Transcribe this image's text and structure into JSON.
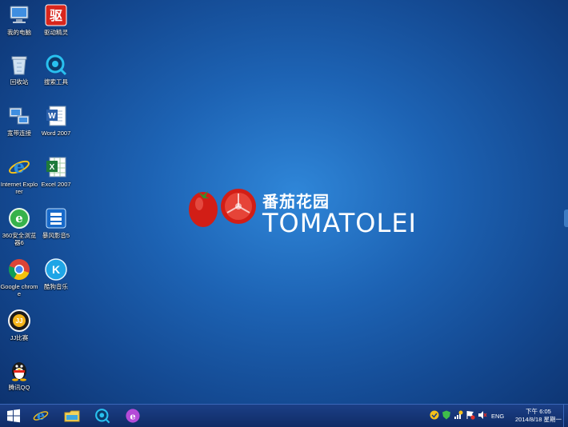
{
  "desktop_icons": [
    {
      "id": "my-computer",
      "label": "我的电脑",
      "icon": "computer-icon"
    },
    {
      "id": "driver-wizard",
      "label": "驱动精灵",
      "icon": "driver-wizard-icon"
    },
    {
      "id": "recycle-bin",
      "label": "回收站",
      "icon": "recycle-bin-icon"
    },
    {
      "id": "search-tool",
      "label": "搜索工具",
      "icon": "magnifier-icon"
    },
    {
      "id": "broadband",
      "label": "宽带连接",
      "icon": "network-icon"
    },
    {
      "id": "word",
      "label": "Word 2007",
      "icon": "word-icon"
    },
    {
      "id": "ie",
      "label": "Internet Explorer",
      "icon": "ie-icon"
    },
    {
      "id": "excel",
      "label": "Excel 2007",
      "icon": "excel-icon"
    },
    {
      "id": "360browser",
      "label": "360安全浏览器6",
      "icon": "360-browser-icon"
    },
    {
      "id": "storm",
      "label": "暴风影音5",
      "icon": "storm-player-icon"
    },
    {
      "id": "chrome",
      "label": "Google chrome",
      "icon": "chrome-icon"
    },
    {
      "id": "kuwo",
      "label": "酷狗音乐",
      "icon": "kugou-icon"
    },
    {
      "id": "jj",
      "label": "JJ比赛",
      "icon": "jj-game-icon"
    },
    {
      "id": "qq",
      "label": "腾讯QQ",
      "icon": "qq-penguin-icon"
    }
  ],
  "logo": {
    "cn": "番茄花园",
    "en": "TOMATOLEI"
  },
  "taskbar": {
    "pinned": [
      "ie-icon",
      "file-explorer-icon",
      "search-tool-icon",
      "ie-alt-icon"
    ],
    "language": "ENG",
    "clock_time": "下午 6:05",
    "clock_date": "2014/8/18 星期一"
  },
  "colors": {
    "desktop": "#1d63b4",
    "taskbar": "#132f6b",
    "accent": "#e3312a"
  }
}
